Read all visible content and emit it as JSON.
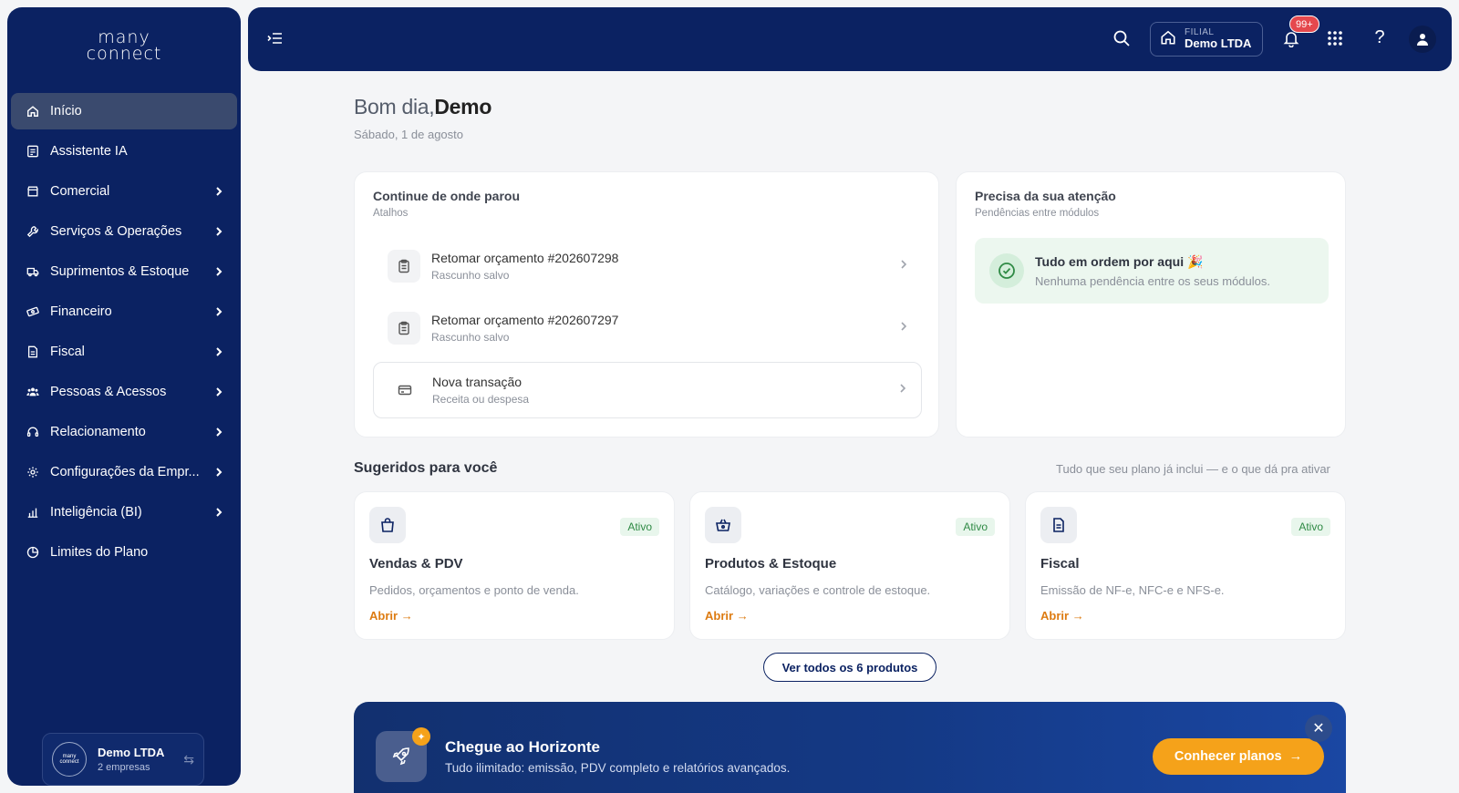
{
  "brand": {
    "line1": "many",
    "line2": "connect"
  },
  "sidebar": {
    "items": [
      {
        "label": "Início",
        "icon": "home-icon",
        "active": true,
        "chevron": false
      },
      {
        "label": "Assistente IA",
        "icon": "assistant-icon",
        "chevron": false
      },
      {
        "label": "Comercial",
        "icon": "store-icon",
        "chevron": true
      },
      {
        "label": "Serviços & Operações",
        "icon": "wrench-icon",
        "chevron": true
      },
      {
        "label": "Suprimentos & Estoque",
        "icon": "truck-icon",
        "chevron": true
      },
      {
        "label": "Financeiro",
        "icon": "money-icon",
        "chevron": true
      },
      {
        "label": "Fiscal",
        "icon": "document-icon",
        "chevron": true
      },
      {
        "label": "Pessoas & Acessos",
        "icon": "people-icon",
        "chevron": true
      },
      {
        "label": "Relacionamento",
        "icon": "headset-icon",
        "chevron": true
      },
      {
        "label": "Configurações da Empr...",
        "icon": "gear-icon",
        "chevron": true
      },
      {
        "label": "Inteligência (BI)",
        "icon": "bi-icon",
        "chevron": true
      },
      {
        "label": "Limites do Plano",
        "icon": "pie-icon",
        "chevron": false
      }
    ],
    "company": {
      "name": "Demo LTDA",
      "sub": "2 empresas",
      "avatar_l1": "many",
      "avatar_l2": "connect"
    }
  },
  "topbar": {
    "filial_label": "FILIAL",
    "filial_name": "Demo LTDA",
    "notif_badge": "99+",
    "help": "?"
  },
  "greeting": {
    "prefix": "Bom dia,",
    "name": "Demo",
    "date": "Sábado, 1 de agosto"
  },
  "continue": {
    "title": "Continue de onde parou",
    "subtitle": "Atalhos",
    "rows": [
      {
        "title": "Retomar orçamento #202607298",
        "sub": "Rascunho salvo"
      },
      {
        "title": "Retomar orçamento #202607297",
        "sub": "Rascunho salvo"
      },
      {
        "title": "Nova transação",
        "sub": "Receita ou despesa"
      }
    ]
  },
  "attention": {
    "title": "Precisa da sua atenção",
    "subtitle": "Pendências entre módulos",
    "ok_title": "Tudo em ordem por aqui 🎉",
    "ok_sub": "Nenhuma pendência entre os seus módulos."
  },
  "suggested": {
    "title": "Sugeridos para você",
    "right": "Tudo que seu plano já inclui — e o que dá pra ativar",
    "cards": [
      {
        "title": "Vendas & PDV",
        "desc": "Pedidos, orçamentos e ponto de venda.",
        "badge": "Ativo",
        "action": "Abrir",
        "icon": "bag-icon"
      },
      {
        "title": "Produtos & Estoque",
        "desc": "Catálogo, variações e controle de estoque.",
        "badge": "Ativo",
        "action": "Abrir",
        "icon": "basket-icon"
      },
      {
        "title": "Fiscal",
        "desc": "Emissão de NF-e, NFC-e e NFS-e.",
        "badge": "Ativo",
        "action": "Abrir",
        "icon": "invoice-icon"
      }
    ],
    "see_all": "Ver todos os 6 produtos"
  },
  "promo": {
    "title": "Chegue ao Horizonte",
    "sub": "Tudo ilimitado: emissão, PDV completo e relatórios avançados.",
    "cta": "Conhecer planos"
  }
}
